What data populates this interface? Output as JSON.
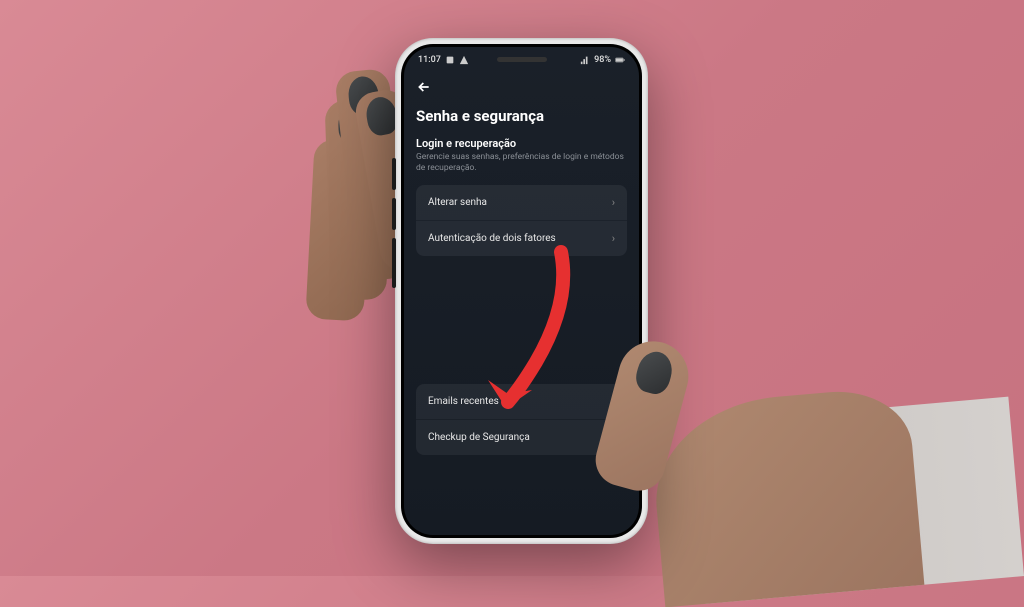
{
  "status_bar": {
    "time": "11:07",
    "battery_pct": "98%"
  },
  "page": {
    "title": "Senha e segurança"
  },
  "section": {
    "title": "Login e recuperação",
    "description": "Gerencie suas senhas, preferências de login e métodos de recuperação."
  },
  "menu_group_1": [
    {
      "label": "Alterar senha"
    },
    {
      "label": "Autenticação de dois fatores"
    }
  ],
  "menu_group_2": [
    {
      "label": "Emails recentes"
    },
    {
      "label": "Checkup de Segurança"
    }
  ],
  "annotation": {
    "color": "#e63030"
  }
}
